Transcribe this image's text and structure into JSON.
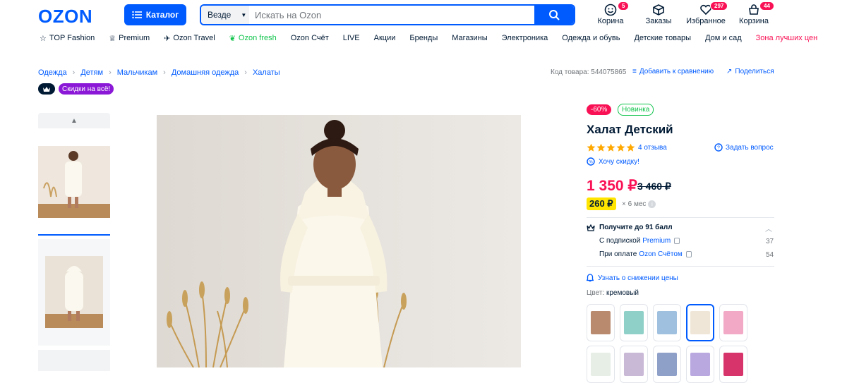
{
  "header": {
    "logo": "OZON",
    "catalog": "Каталог",
    "search_scope": "Везде",
    "search_placeholder": "Искать на Ozon",
    "icons": [
      {
        "label": "Корина",
        "badge": "5",
        "icon": "user-icon"
      },
      {
        "label": "Заказы",
        "badge": "",
        "icon": "box-icon"
      },
      {
        "label": "Избранное",
        "badge": "297",
        "icon": "heart-icon"
      },
      {
        "label": "Корзина",
        "badge": "44",
        "icon": "cart-icon"
      }
    ]
  },
  "nav": [
    "TOP Fashion",
    "Premium",
    "Ozon Travel",
    "Ozon fresh",
    "Ozon Счёт",
    "LIVE",
    "Акции",
    "Бренды",
    "Магазины",
    "Электроника",
    "Одежда и обувь",
    "Детские товары",
    "Дом и сад",
    "Зона лучших цен"
  ],
  "breadcrumbs": [
    "Одежда",
    "Детям",
    "Мальчикам",
    "Домашняя одежда",
    "Халаты"
  ],
  "product_code": "Код товара: 544075865",
  "compare": "Добавить к сравнению",
  "share": "Поделиться",
  "discount_pill": "Скидки на всё!",
  "product": {
    "sale_tag": "-60%",
    "new_tag": "Новинка",
    "title": "Халат Детский",
    "rating": 5,
    "reviews": "4 отзыва",
    "ask": "Задать вопрос",
    "want_discount": "Хочу скидку!",
    "price": "1 350 ₽",
    "old_price": "3 460 ₽",
    "installment": "260 ₽",
    "installment_term": "× 6 мес",
    "points_title": "Получите до 91 балл",
    "points": [
      {
        "prefix": "С подпиской",
        "link": "Premium",
        "value": "37"
      },
      {
        "prefix": "При оплате",
        "link": "Ozon Счётом",
        "value": "54"
      }
    ],
    "notify": "Узнать о снижении цены",
    "color_label": "Цвет:",
    "color_value": "кремовый",
    "swatches": [
      "#b98a6e",
      "#8fd0c8",
      "#9fc0de",
      "#efe6d8",
      "#f2a9c6"
    ],
    "swatches2": [
      "#e6eee6",
      "#c9b8d6",
      "#8fa0c8",
      "#b9a8e0",
      "#d8346c"
    ]
  }
}
